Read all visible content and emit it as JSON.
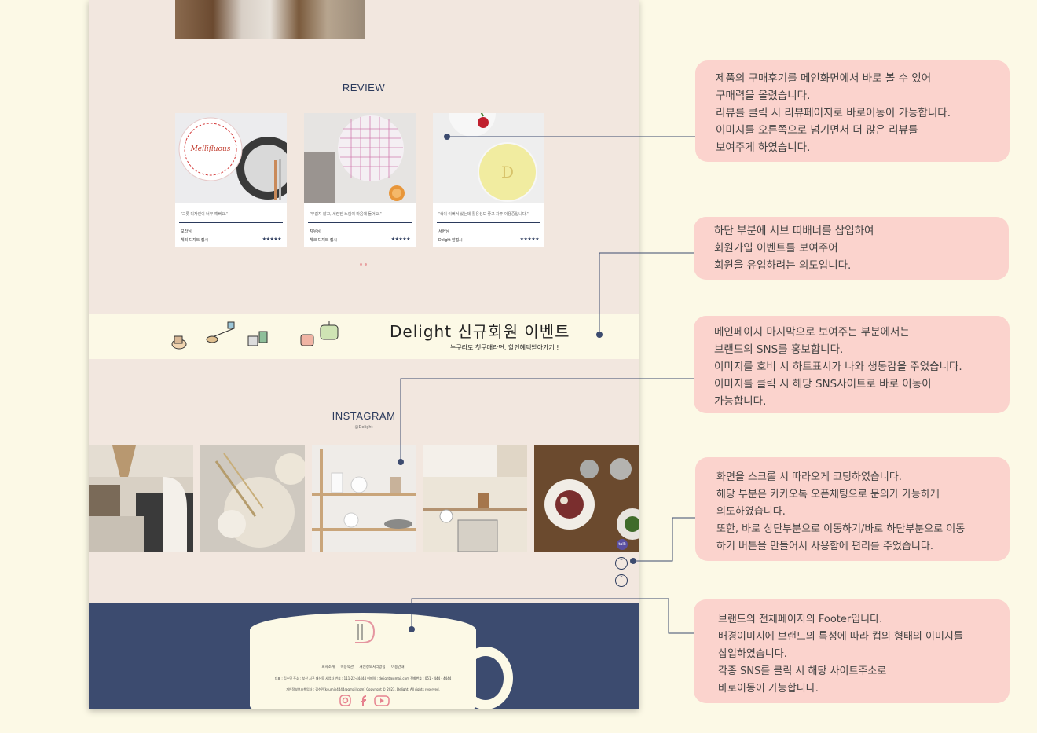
{
  "review": {
    "title": "REVIEW",
    "cards": [
      {
        "quote": "\"그릇 디자인이 너무 예뻐요.\"",
        "name": "보라님",
        "product": "체리 디자트 접시",
        "stars": "★★★★★",
        "img_label": "Mellifluous"
      },
      {
        "quote": "\"무겁지 않고, 세련된 느낌이 마음에 들어요.\"",
        "name": "지우님",
        "product": "체크 디저트 접시",
        "stars": "★★★★★",
        "img_label": ""
      },
      {
        "quote": "\"색이 이뻐서 샀는데 활용성도 좋고 자주 이용중입니다.\"",
        "name": "서현님",
        "product": "Delight 앞접시",
        "stars": "★★★★★",
        "img_label": "D"
      }
    ]
  },
  "banner": {
    "title": "Delight 신규회원 이벤트",
    "subtitle": "누구라도 첫구매라면, 할인혜택받아가기 !"
  },
  "instagram": {
    "title": "INSTAGRAM",
    "handle": "@Delight"
  },
  "scroll": {
    "up": "˄",
    "down": "˅",
    "kakao": "talk"
  },
  "footer": {
    "logo": "D",
    "links": "회사소개 이용약관 개인정보처리방침 이용안내",
    "info1": "대표 : 김수민 주소 : 부산 서구 대신동 사업자 번호 : 111-22-44444 이메일 : delight@gmail.com 전화번호 : 051 - 444 - 4444",
    "info2": "개인정보보호책임자 : 김수민(ksumin4444@gmail.com) Copyright © 2023. Delight. All rights reserved."
  },
  "notes": [
    {
      "lines": [
        "제품의 구매후기를 메인화면에서 바로 볼 수 있어",
        "구매력을 올렸습니다.",
        "리뷰를 클릭 시 리뷰페이지로 바로이동이 가능합니다.",
        "이미지를 오른쪽으로 넘기면서 더 많은 리뷰를",
        "보여주게 하였습니다."
      ]
    },
    {
      "lines": [
        "하단 부분에 서브 띠배너를 삽입하여",
        "회원가입 이벤트를 보여주어",
        "회원을 유입하려는 의도입니다."
      ]
    },
    {
      "lines": [
        "메인페이지 마지막으로 보여주는 부분에서는",
        "브랜드의 SNS를 홍보합니다.",
        "이미지를 호버 시 하트표시가 나와 생동감을 주었습니다.",
        "이미지를 클릭 시 해당 SNS사이트로 바로 이동이",
        "가능합니다."
      ]
    },
    {
      "lines": [
        "화면을 스크롤 시 따라오게 코딩하였습니다.",
        "해당 부분은 카카오톡 오픈채팅으로 문의가 가능하게",
        "의도하였습니다.",
        "또한, 바로 상단부분으로 이동하기/바로 하단부분으로 이동",
        "하기 버튼을 만들어서 사용함에 편리를 주었습니다."
      ]
    },
    {
      "lines": [
        "브랜드의 전체페이지의 Footer입니다.",
        "배경이미지에 브랜드의 특성에 따라 컵의 형태의 이미지를",
        "삽입하였습니다.",
        "각종 SNS를 클릭 시 해당 사이트주소로",
        "바로이동이 가능합니다."
      ]
    }
  ],
  "colors": {
    "page_bg": "#fcf9e6",
    "content_bg": "#f2e7df",
    "navy": "#2b3a5c",
    "footer_bg": "#3c4b6f",
    "note_bg": "#fbd3cd",
    "cream": "#fcf9e6"
  }
}
